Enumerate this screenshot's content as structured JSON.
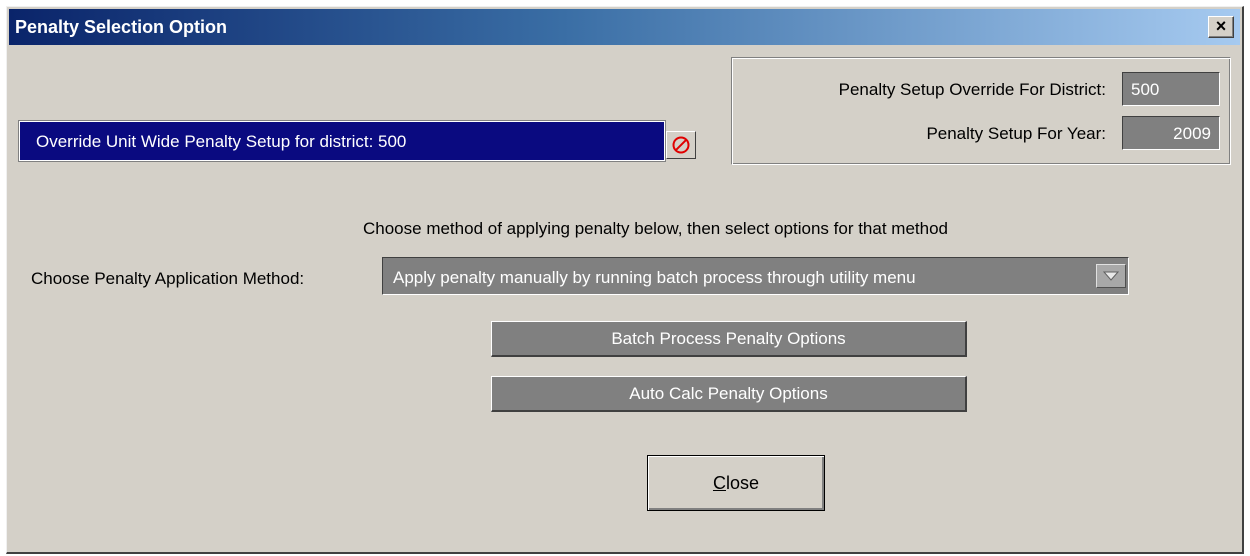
{
  "window": {
    "title": "Penalty Selection Option",
    "close_glyph": "×"
  },
  "override": {
    "text": "Override Unit Wide Penalty Setup for district: 500",
    "icon": "prohibited-icon"
  },
  "info": {
    "district_label": "Penalty Setup Override For District:",
    "district_value": "500",
    "year_label": "Penalty Setup For Year:",
    "year_value": "2009"
  },
  "instruction": "Choose method of applying penalty below, then select options for that method",
  "method": {
    "label": "Choose Penalty Application Method:",
    "selected": "Apply penalty manually by running batch process through utility menu"
  },
  "buttons": {
    "batch": "Batch Process Penalty Options",
    "auto_calc": "Auto Calc Penalty Options",
    "close_mnemonic": "C",
    "close_rest": "lose"
  },
  "colors": {
    "title_start": "#0a246a",
    "title_end": "#a6caf0",
    "override_bg": "#0a0a80",
    "dialog_bg": "#d4d0c8",
    "prohibit_red": "#e00000"
  }
}
